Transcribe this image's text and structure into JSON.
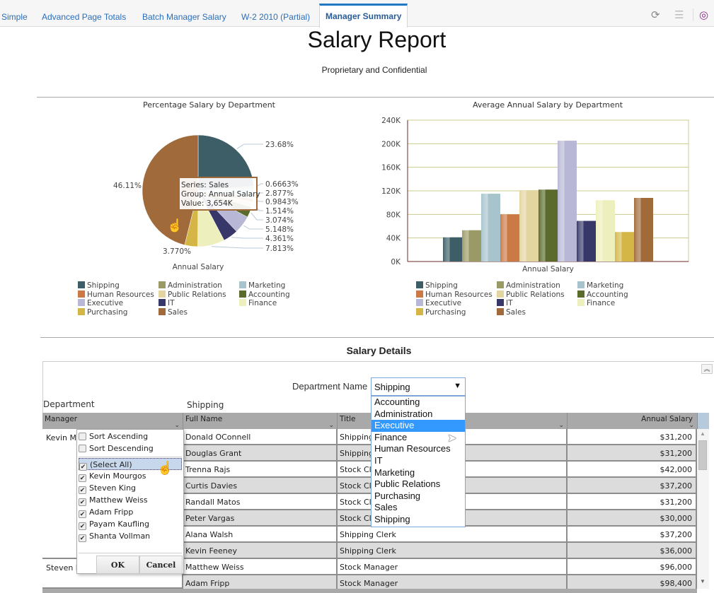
{
  "tabs": [
    {
      "label": "Simple",
      "active": false
    },
    {
      "label": "Advanced Page Totals",
      "active": false
    },
    {
      "label": "Batch Manager Salary",
      "active": false
    },
    {
      "label": "W-2 2010 (Partial)",
      "active": false
    },
    {
      "label": "Manager Summary",
      "active": true
    }
  ],
  "toolbar_icons": [
    "refresh-icon",
    "list-icon",
    "analytics-icon"
  ],
  "report": {
    "title": "Salary Report",
    "subtitle": "Proprietary and Confidential"
  },
  "colors": {
    "Shipping": "#3d5e66",
    "Administration": "#9a9a66",
    "Marketing": "#a7c4cc",
    "Human Resources": "#cc7a45",
    "Public Relations": "#e2d59f",
    "Accounting": "#5a6b2c",
    "Executive": "#b8b8d6",
    "IT": "#37376a",
    "Finance": "#edf0bc",
    "Purchasing": "#d4b646",
    "Sales": "#a06a3a",
    "tab_active": "#1f78c1",
    "select_highlight": "#3399ff"
  },
  "chart_data": [
    {
      "type": "pie",
      "title": "Percentage Salary by Department",
      "xlabel": "Annual Salary",
      "categories": [
        "Shipping",
        "Administration",
        "Marketing",
        "Human Resources",
        "Public Relations",
        "Accounting",
        "Executive",
        "IT",
        "Finance",
        "Purchasing",
        "Sales"
      ],
      "values": [
        23.68,
        0.6663,
        2.877,
        0.9843,
        1.514,
        3.074,
        5.148,
        4.361,
        7.813,
        3.77,
        46.11
      ],
      "labels": [
        "23.68%",
        "0.6663%",
        "2.877%",
        "0.9843%",
        "1.514%",
        "3.074%",
        "5.148%",
        "4.361%",
        "7.813%",
        "3.770%",
        "46.11%"
      ],
      "tooltip": {
        "line1": "Series: Sales",
        "line2": "Group: Annual Salary",
        "line3": "Value: 3,654K"
      },
      "legend": "bottom"
    },
    {
      "type": "bar",
      "title": "Average Annual Salary by Department",
      "xlabel": "Annual Salary",
      "ylabel": "",
      "categories": [
        "Annual Salary"
      ],
      "series": [
        {
          "name": "Shipping",
          "values": [
            41000
          ]
        },
        {
          "name": "Administration",
          "values": [
            53000
          ]
        },
        {
          "name": "Marketing",
          "values": [
            115000
          ]
        },
        {
          "name": "Human Resources",
          "values": [
            80000
          ]
        },
        {
          "name": "Public Relations",
          "values": [
            121000
          ]
        },
        {
          "name": "Accounting",
          "values": [
            122000
          ]
        },
        {
          "name": "Executive",
          "values": [
            205000
          ]
        },
        {
          "name": "IT",
          "values": [
            69000
          ]
        },
        {
          "name": "Finance",
          "values": [
            104000
          ]
        },
        {
          "name": "Purchasing",
          "values": [
            50000
          ]
        },
        {
          "name": "Sales",
          "values": [
            108000
          ]
        }
      ],
      "ylim": [
        0,
        240000
      ],
      "yticks": [
        "0K",
        "40K",
        "80K",
        "120K",
        "160K",
        "200K",
        "240K"
      ],
      "grid": true,
      "legend": "bottom"
    }
  ],
  "details": {
    "title": "Salary Details",
    "dept_name_label": "Department Name",
    "dept_selected": "Shipping",
    "dept_options": [
      "Accounting",
      "Administration",
      "Executive",
      "Finance",
      "Human Resources",
      "IT",
      "Marketing",
      "Public Relations",
      "Purchasing",
      "Sales",
      "Shipping"
    ],
    "dept_highlighted": "Executive",
    "department_label": "Department",
    "department_value": "Shipping",
    "columns": [
      "Manager",
      "Full Name",
      "Title",
      "Annual Salary"
    ],
    "managers": [
      "Kevin Mourgos",
      "Steven King"
    ],
    "rows": [
      {
        "name": "Donald OConnell",
        "title": "Shipping Clerk",
        "salary": "$31,200"
      },
      {
        "name": "Douglas Grant",
        "title": "Shipping Clerk",
        "salary": "$31,200"
      },
      {
        "name": "Trenna Rajs",
        "title": "Stock Clerk",
        "salary": "$42,000"
      },
      {
        "name": "Curtis Davies",
        "title": "Stock Clerk",
        "salary": "$37,200"
      },
      {
        "name": "Randall Matos",
        "title": "Stock Clerk",
        "salary": "$31,200"
      },
      {
        "name": "Peter Vargas",
        "title": "Stock Clerk",
        "salary": "$30,000"
      },
      {
        "name": "Alana Walsh",
        "title": "Shipping Clerk",
        "salary": "$37,200"
      },
      {
        "name": "Kevin Feeney",
        "title": "Shipping Clerk",
        "salary": "$36,000"
      },
      {
        "name": "Matthew Weiss",
        "title": "Stock Manager",
        "salary": "$96,000"
      },
      {
        "name": "Adam Fripp",
        "title": "Stock Manager",
        "salary": "$98,400"
      }
    ],
    "filter_menu": {
      "sort_asc": "Sort Ascending",
      "sort_desc": "Sort Descending",
      "options": [
        "(Select All)",
        "Kevin Mourgos",
        "Steven King",
        "Matthew Weiss",
        "Adam Fripp",
        "Payam Kaufling",
        "Shanta Vollman"
      ],
      "ok": "OK",
      "cancel": "Cancel"
    }
  }
}
